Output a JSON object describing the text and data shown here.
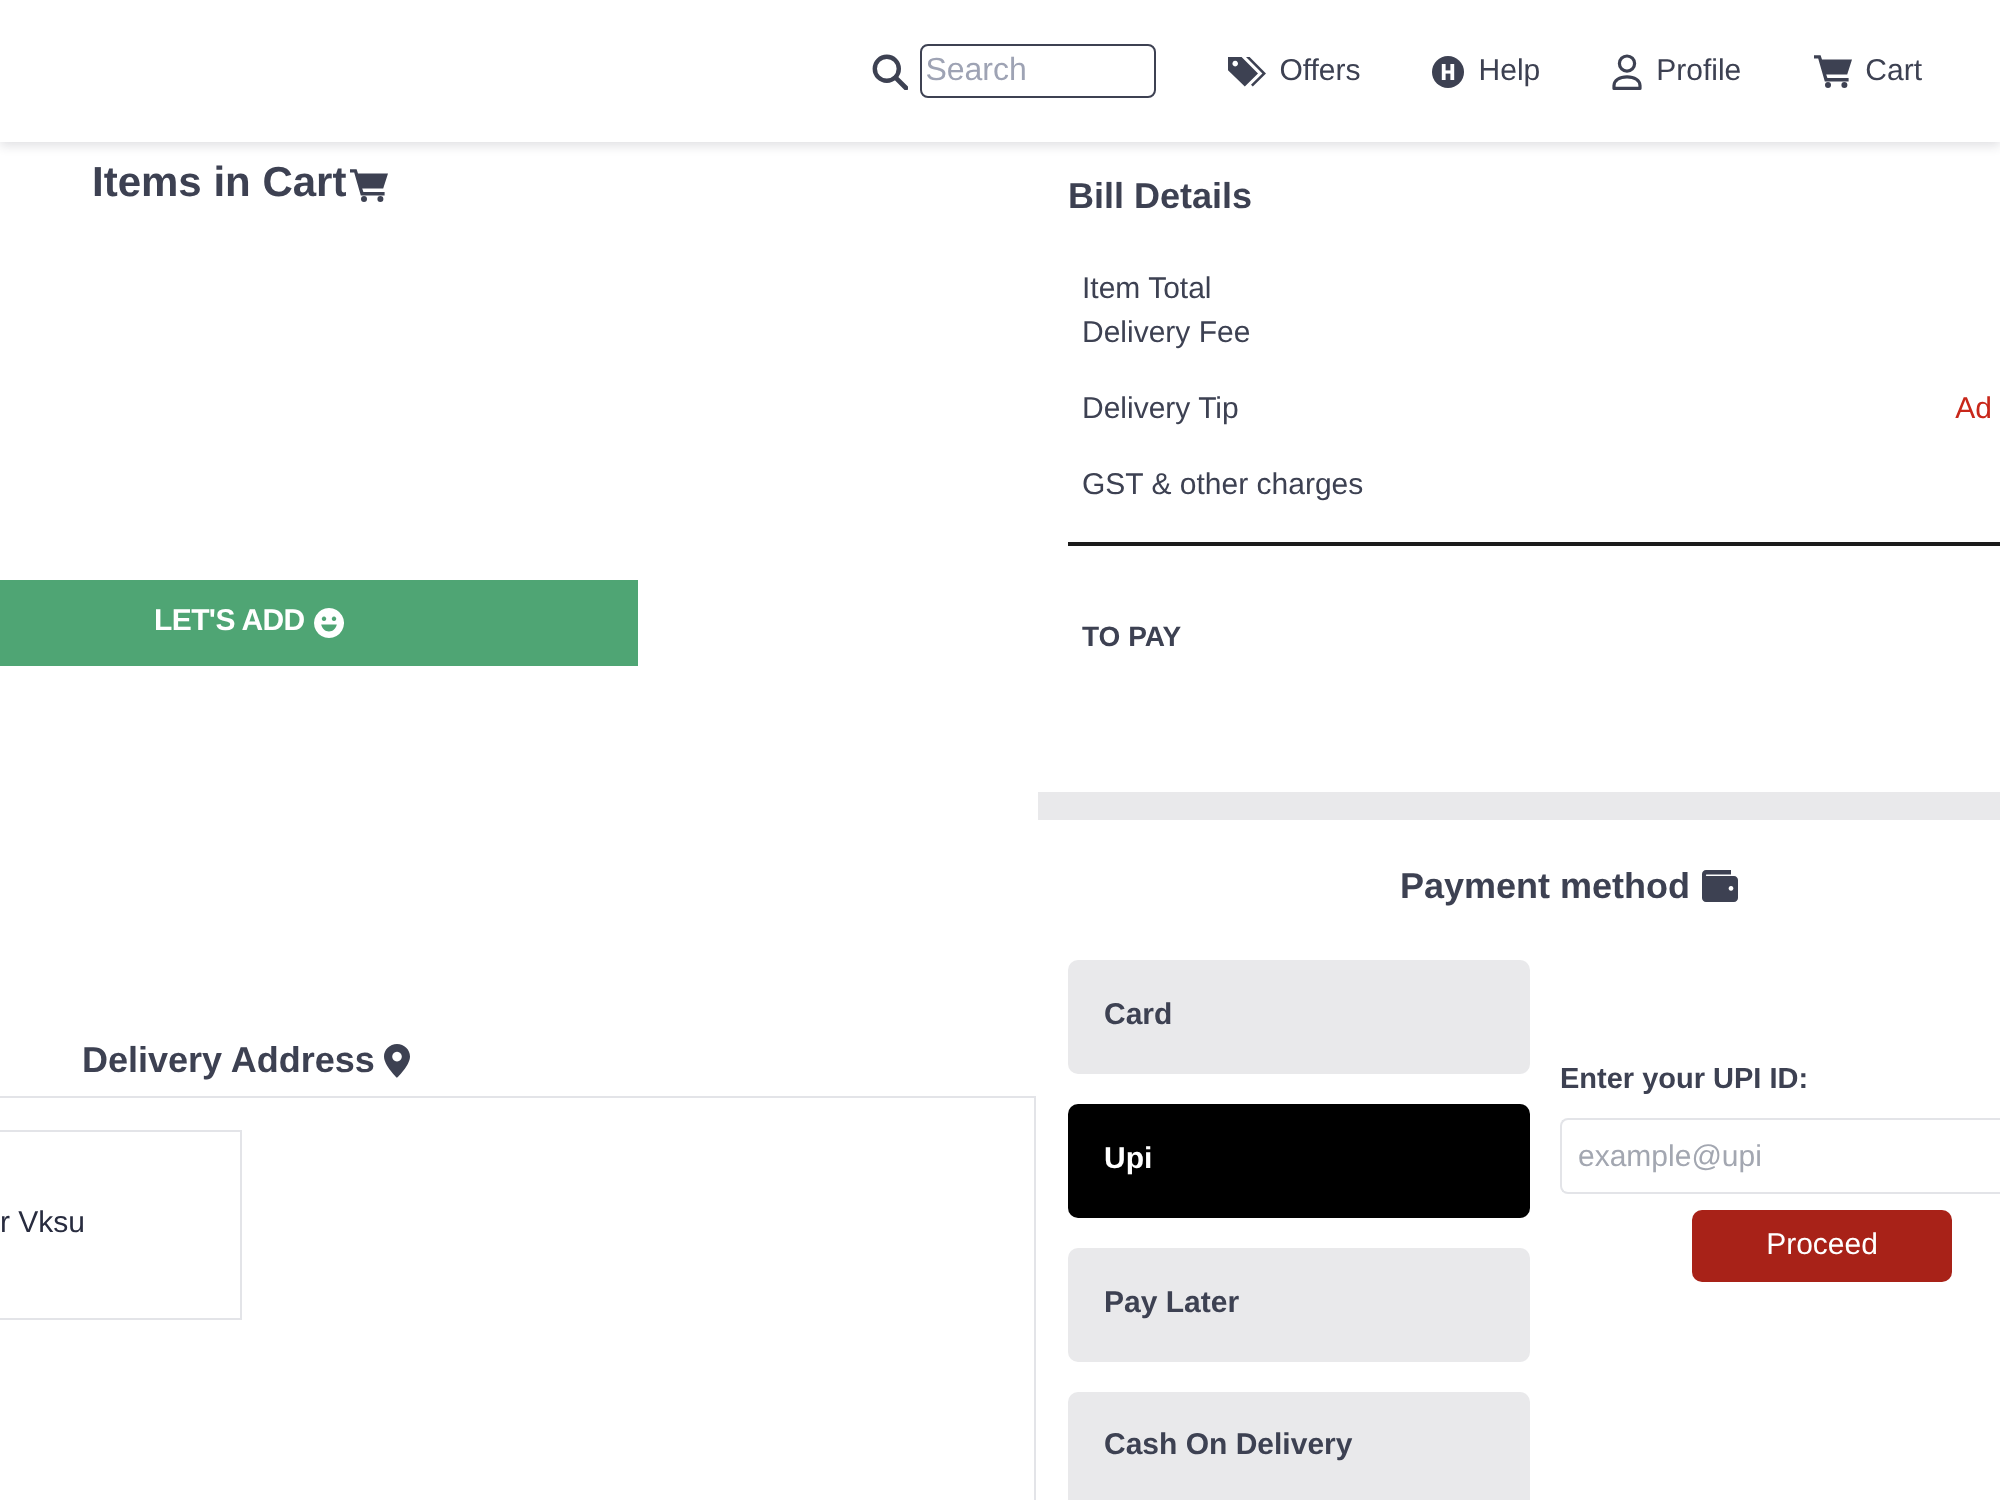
{
  "navbar": {
    "search": {
      "placeholder": "Search"
    },
    "links": [
      {
        "label": "Offers"
      },
      {
        "label": "Help"
      },
      {
        "label": "Profile"
      },
      {
        "label": "Cart"
      }
    ]
  },
  "cart": {
    "title": "Items in Cart",
    "add_button": "LET'S ADD"
  },
  "delivery_address": {
    "title": "Delivery Address",
    "addresses": [
      {
        "text": "r Vksu"
      }
    ]
  },
  "bill_details": {
    "title": "Bill Details",
    "rows": [
      {
        "label": "Item Total"
      },
      {
        "label": "Delivery Fee"
      },
      {
        "label": "Delivery Tip",
        "action": "Ad"
      },
      {
        "label": "GST & other charges"
      }
    ],
    "total_label": "TO PAY"
  },
  "payment": {
    "title": "Payment method",
    "methods": [
      {
        "label": "Card",
        "selected": false
      },
      {
        "label": "Upi",
        "selected": true
      },
      {
        "label": "Pay Later",
        "selected": false
      },
      {
        "label": "Cash On Delivery",
        "selected": false
      }
    ],
    "upi": {
      "label": "Enter your UPI ID:",
      "placeholder": "example@upi",
      "button": "Proceed"
    }
  }
}
